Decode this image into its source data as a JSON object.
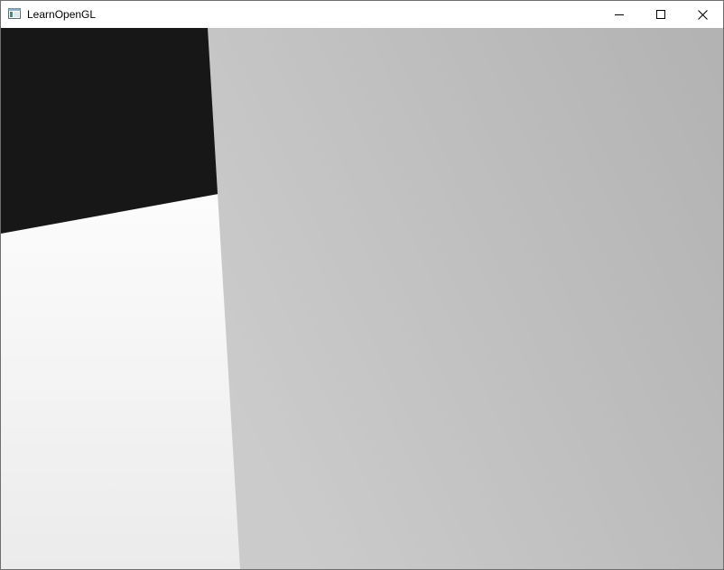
{
  "window": {
    "title": "LearnOpenGL",
    "icon": "app-window-icon",
    "controls": {
      "minimize_icon": "minimize-icon",
      "maximize_icon": "maximize-icon",
      "close_icon": "close-icon"
    }
  },
  "scene": {
    "background_color": "#171717",
    "floor_color_near": "#ebebeb",
    "floor_color_far": "#fcfcfc",
    "wall_color_left": "#cbcbcb",
    "wall_color_right": "#b3b3b3"
  }
}
